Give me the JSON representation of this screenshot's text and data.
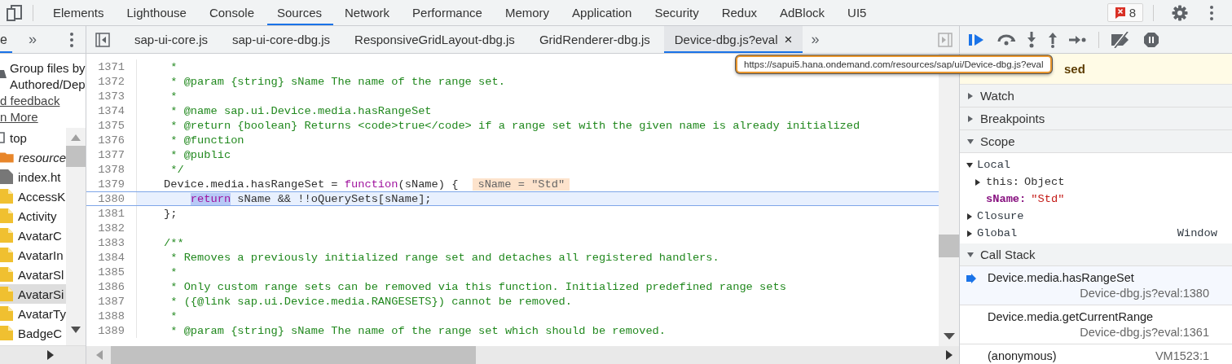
{
  "main_tabs": [
    {
      "label": "Elements",
      "selected": false
    },
    {
      "label": "Lighthouse",
      "selected": false
    },
    {
      "label": "Console",
      "selected": false
    },
    {
      "label": "Sources",
      "selected": true
    },
    {
      "label": "Network",
      "selected": false
    },
    {
      "label": "Performance",
      "selected": false
    },
    {
      "label": "Memory",
      "selected": false
    },
    {
      "label": "Application",
      "selected": false
    },
    {
      "label": "Security",
      "selected": false
    },
    {
      "label": "Redux",
      "selected": false
    },
    {
      "label": "AdBlock",
      "selected": false
    },
    {
      "label": "UI5",
      "selected": false
    }
  ],
  "error_count": "8",
  "navigator": {
    "tab_label": "e",
    "more": "»",
    "group_option": [
      "Group files by",
      "Authored/Dep"
    ],
    "links": [
      "d feedback",
      "n More"
    ],
    "tree": [
      {
        "label": "top",
        "kind": "frame",
        "selected": false,
        "children": [
          {
            "label": "resource",
            "kind": "folder",
            "selected": false
          },
          {
            "label": "index.ht",
            "kind": "document",
            "selected": false
          },
          {
            "label": "AccessK",
            "kind": "script",
            "selected": false
          },
          {
            "label": "Activity",
            "kind": "script",
            "selected": false
          },
          {
            "label": "AvatarC",
            "kind": "script",
            "selected": false
          },
          {
            "label": "AvatarIn",
            "kind": "script",
            "selected": false
          },
          {
            "label": "AvatarSl",
            "kind": "script",
            "selected": false
          },
          {
            "label": "AvatarSi",
            "kind": "script",
            "selected": true
          },
          {
            "label": "AvatarTy",
            "kind": "script",
            "selected": false
          },
          {
            "label": "BadgeC",
            "kind": "script",
            "selected": false
          }
        ]
      }
    ]
  },
  "editor": {
    "file_tabs": [
      {
        "label": "sap-ui-core.js",
        "selected": false
      },
      {
        "label": "sap-ui-core-dbg.js",
        "selected": false
      },
      {
        "label": "ResponsiveGridLayout-dbg.js",
        "selected": false
      },
      {
        "label": "GridRenderer-dbg.js",
        "selected": false
      },
      {
        "label": "Device-dbg.js?eval",
        "selected": true,
        "close": "×"
      }
    ],
    "more_tabs": "»",
    "lines": [
      {
        "number": "1371",
        "current": false,
        "segments": [
          {
            "text": " *",
            "kind": "comment"
          }
        ]
      },
      {
        "number": "1372",
        "current": false,
        "segments": [
          {
            "text": " * @param {string} sName The name of the range set.",
            "kind": "comment"
          }
        ]
      },
      {
        "number": "1373",
        "current": false,
        "segments": [
          {
            "text": " *",
            "kind": "comment"
          }
        ]
      },
      {
        "number": "1374",
        "current": false,
        "segments": [
          {
            "text": " * @name sap.ui.Device.media.hasRangeSet",
            "kind": "comment"
          }
        ]
      },
      {
        "number": "1375",
        "current": false,
        "segments": [
          {
            "text": " * @return {boolean} Returns <code>true</code> if a range set with the given name is already initialized",
            "kind": "comment"
          }
        ]
      },
      {
        "number": "1376",
        "current": false,
        "segments": [
          {
            "text": " * @function",
            "kind": "comment"
          }
        ]
      },
      {
        "number": "1377",
        "current": false,
        "segments": [
          {
            "text": " * @public",
            "kind": "comment"
          }
        ]
      },
      {
        "number": "1378",
        "current": false,
        "segments": [
          {
            "text": " */",
            "kind": "comment"
          }
        ]
      },
      {
        "number": "1379",
        "current": false,
        "segments": [
          {
            "text": "Device.media.hasRangeSet = ",
            "kind": "plain"
          },
          {
            "text": "function",
            "kind": "keyword"
          },
          {
            "text": "(sName) {",
            "kind": "plain"
          }
        ],
        "inline_value": "sName = \"Std\""
      },
      {
        "number": "1380",
        "current": true,
        "indented": true,
        "segments": [
          {
            "text": "return",
            "kind": "selected_keyword"
          },
          {
            "text": " sName && !!oQuerySets[sName];",
            "kind": "plain"
          }
        ]
      },
      {
        "number": "1381",
        "current": false,
        "segments": [
          {
            "text": "};",
            "kind": "plain"
          }
        ]
      },
      {
        "number": "1382",
        "current": false
      },
      {
        "number": "1383",
        "current": false,
        "segments": [
          {
            "text": "/**",
            "kind": "comment"
          }
        ]
      },
      {
        "number": "1384",
        "current": false,
        "segments": [
          {
            "text": " * Removes a previously initialized range set and detaches all registered handlers.",
            "kind": "comment"
          }
        ]
      },
      {
        "number": "1385",
        "current": false,
        "segments": [
          {
            "text": " *",
            "kind": "comment"
          }
        ]
      },
      {
        "number": "1386",
        "current": false,
        "segments": [
          {
            "text": " * Only custom range sets can be removed via this function. Initialized predefined range sets",
            "kind": "comment"
          }
        ]
      },
      {
        "number": "1387",
        "current": false,
        "segments": [
          {
            "text": " * ({@link sap.ui.Device.media.RANGESETS}) cannot be removed.",
            "kind": "comment"
          }
        ]
      },
      {
        "number": "1388",
        "current": false,
        "segments": [
          {
            "text": " *",
            "kind": "comment"
          }
        ]
      },
      {
        "number": "1389",
        "current": false,
        "segments": [
          {
            "text": " * @param {string} sName The name of the range set which should be removed.",
            "kind": "comment"
          }
        ]
      }
    ],
    "tooltip": "https://sapui5.hana.ondemand.com/resources/sap/ui/Device-dbg.js?eval"
  },
  "debugger": {
    "paused_banner": "sed",
    "sections": [
      {
        "title": "Watch",
        "expanded": false
      },
      {
        "title": "Breakpoints",
        "expanded": false
      },
      {
        "title": "Scope",
        "expanded": true,
        "kind": "scope",
        "scopes": [
          {
            "name": "Local",
            "expanded": true,
            "variables": [
              {
                "label": "this:",
                "value": "Object",
                "kind": "object"
              },
              {
                "label": "sName:",
                "value": "\"Std\"",
                "kind": "string"
              }
            ]
          },
          {
            "name": "Closure",
            "expanded": false
          },
          {
            "name": "Global",
            "expanded": false,
            "value": "Window"
          }
        ]
      },
      {
        "title": "Call Stack",
        "expanded": true,
        "kind": "callstack",
        "frames": [
          {
            "function": "Device.media.hasRangeSet",
            "location": "Device-dbg.js?eval:1380",
            "current": true
          },
          {
            "function": "Device.media.getCurrentRange",
            "location": "Device-dbg.js?eval:1361",
            "current": false
          },
          {
            "function": "(anonymous)",
            "location": "VM1523:1",
            "current": false
          }
        ]
      }
    ]
  }
}
